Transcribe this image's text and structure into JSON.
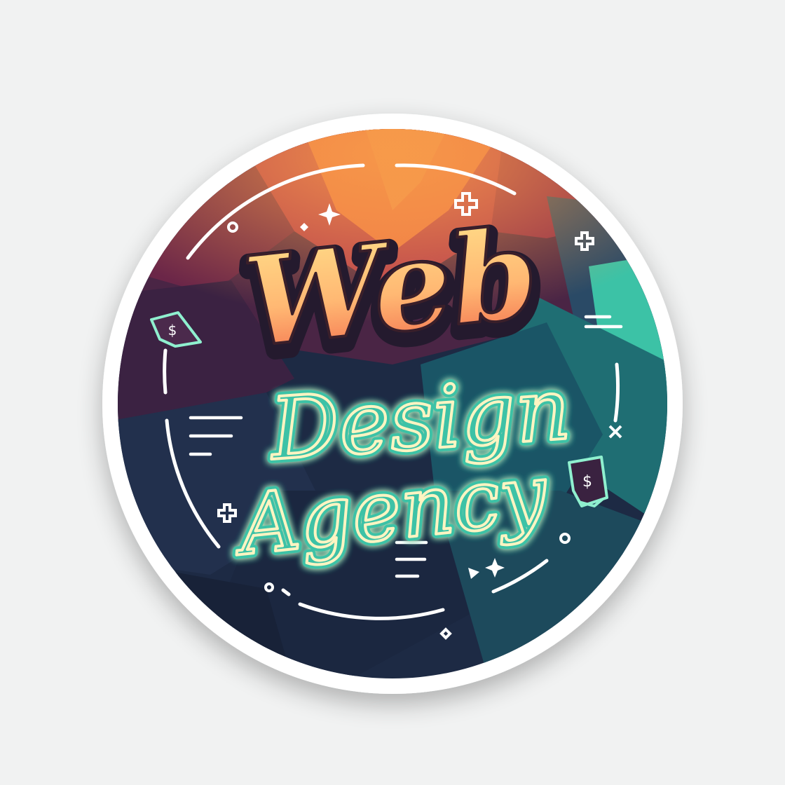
{
  "logo": {
    "title": "Web",
    "line2": "Design",
    "line3": "Agency",
    "badge_glyph": "$"
  },
  "colors": {
    "page_bg": "#f1f2f2",
    "sticker_border": "#ffffff",
    "bg_orange": "#ef7a45",
    "bg_crimson": "#8e2a4a",
    "bg_plum": "#4a2545",
    "bg_navy": "#1d2a44",
    "bg_teal": "#1f6e73",
    "bg_mint": "#3cc2a6",
    "title_top": "#ffd27a",
    "title_bottom": "#f2764f",
    "neon_text": "#fff4c2",
    "neon_glow": "#3cc2a6",
    "line_white": "#ffffff"
  }
}
